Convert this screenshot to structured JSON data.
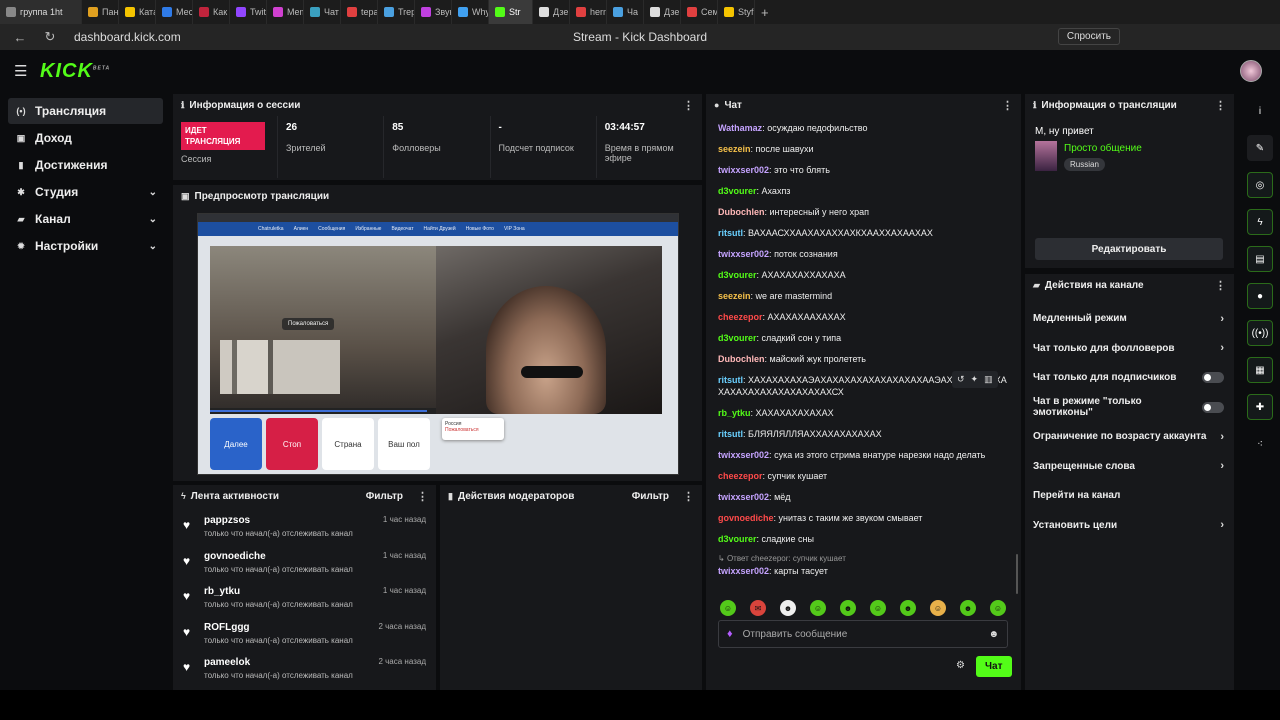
{
  "browser": {
    "tabs": [
      {
        "label": "группа 1ht",
        "icon": "speaker-icon",
        "color": "#888888"
      },
      {
        "label": "Пане",
        "icon": "tab-favicon",
        "color": "#e0a020"
      },
      {
        "label": "Катал",
        "icon": "tab-favicon",
        "color": "#f5c400"
      },
      {
        "label": "Месс",
        "icon": "tab-favicon",
        "color": "#2f7be8"
      },
      {
        "label": "Как о",
        "icon": "tab-favicon",
        "color": "#c0243c"
      },
      {
        "label": "Twitc",
        "icon": "tab-favicon",
        "color": "#9146ff"
      },
      {
        "label": "Memr",
        "icon": "tab-favicon",
        "color": "#d040d0"
      },
      {
        "label": "Чат р",
        "icon": "tab-favicon",
        "color": "#3aa0c0"
      },
      {
        "label": "tepa",
        "icon": "tab-favicon",
        "color": "#e04040"
      },
      {
        "label": "Trepa",
        "icon": "tab-favicon",
        "color": "#4aa0e0"
      },
      {
        "label": "Звук",
        "icon": "tab-favicon",
        "color": "#c040e0"
      },
      {
        "label": "Whyt",
        "icon": "tab-favicon",
        "color": "#40a0f0"
      },
      {
        "label": "Str",
        "icon": "kick-favicon",
        "color": "#53fc18"
      },
      {
        "label": "Дзен",
        "icon": "tab-favicon",
        "color": "#dddddd"
      },
      {
        "label": "herm",
        "icon": "tab-favicon",
        "color": "#e04040"
      },
      {
        "label": "Ча",
        "icon": "tab-favicon",
        "color": "#4aa0e0"
      },
      {
        "label": "Дзен",
        "icon": "tab-favicon",
        "color": "#dddddd"
      },
      {
        "label": "Семь",
        "icon": "tab-favicon",
        "color": "#e04040"
      },
      {
        "label": "Styfn",
        "icon": "tab-favicon",
        "color": "#f5c400"
      }
    ],
    "url": "dashboard.kick.com",
    "page_title": "Stream - Kick Dashboard",
    "ask_label": "Спросить"
  },
  "app": {
    "logo": "KICK",
    "logo_beta": "BETA"
  },
  "sidebar": {
    "items": [
      {
        "label": "Трансляция",
        "icon": "broadcast-icon",
        "glyph": "(•)",
        "active": true,
        "expandable": false
      },
      {
        "label": "Доход",
        "icon": "revenue-icon",
        "glyph": "▣",
        "active": false,
        "expandable": false
      },
      {
        "label": "Достижения",
        "icon": "achievements-icon",
        "glyph": "▮",
        "active": false,
        "expandable": false
      },
      {
        "label": "Студия",
        "icon": "studio-icon",
        "glyph": "✱",
        "active": false,
        "expandable": true
      },
      {
        "label": "Канал",
        "icon": "channel-icon",
        "glyph": "▰",
        "active": false,
        "expandable": true
      },
      {
        "label": "Настройки",
        "icon": "settings-icon",
        "glyph": "✹",
        "active": false,
        "expandable": true
      }
    ]
  },
  "session": {
    "title": "Информация о сессии",
    "live_badge": "ИДЕТ ТРАНСЛЯЦИЯ",
    "session_label": "Сессия",
    "stats": [
      {
        "value": "26",
        "label": "Зрителей"
      },
      {
        "value": "85",
        "label": "Фолловеры"
      },
      {
        "value": "-",
        "label": "Подсчет подписок"
      },
      {
        "value": "03:44:57",
        "label": "Время в прямом эфире"
      }
    ]
  },
  "preview": {
    "title": "Предпросмотр трансляции",
    "site_nav": [
      "Chatruletka",
      "Алиен",
      "Сообщения",
      "Избранные",
      "Видеочат",
      "Найти Друзей",
      "Новые Фото",
      "VIP Зона"
    ],
    "report_label": "Пожаловаться",
    "btn_next": "Далее",
    "btn_stop": "Стоп",
    "btn_country": "Страна",
    "btn_gender": "Ваш пол",
    "popup_country": "Россия",
    "popup_report": "Пожаловаться"
  },
  "activity": {
    "title": "Лента активности",
    "filter_label": "Фильтр",
    "items": [
      {
        "name": "pappzsos",
        "text": "только что начал(-а) отслеживать канал",
        "time": "1 час назад"
      },
      {
        "name": "govnoediche",
        "text": "только что начал(-а) отслеживать канал",
        "time": "1 час назад"
      },
      {
        "name": "rb_ytku",
        "text": "только что начал(-а) отслеживать канал",
        "time": "1 час назад"
      },
      {
        "name": "ROFLggg",
        "text": "только что начал(-а) отслеживать канал",
        "time": "2 часа назад"
      },
      {
        "name": "pameelok",
        "text": "только что начал(-а) отслеживать канал",
        "time": "2 часа назад"
      }
    ]
  },
  "moderator": {
    "title": "Действия модераторов",
    "filter_label": "Фильтр"
  },
  "chat": {
    "title": "Чат",
    "messages": [
      {
        "user": "Wathamaz",
        "color": "#c5a3ff",
        "text": "осуждаю педофильство"
      },
      {
        "user": "seezein",
        "color": "#f5c04a",
        "text": "после шавухи"
      },
      {
        "user": "twixxser002",
        "color": "#c5a3ff",
        "text": "это что блять"
      },
      {
        "user": "d3vourer",
        "color": "#53fc18",
        "text": "Ахахпз"
      },
      {
        "user": "Dubochlen",
        "color": "#ffb8b8",
        "text": "интересный у него храп"
      },
      {
        "user": "ritsutl",
        "color": "#6ad0ff",
        "text": "ВАХААСХХААХАХАХХАХКХААХХАХААХАХ"
      },
      {
        "user": "twixxser002",
        "color": "#c5a3ff",
        "text": "поток сознания"
      },
      {
        "user": "d3vourer",
        "color": "#53fc18",
        "text": "АХАХАХАХХАХАХА"
      },
      {
        "user": "seezein",
        "color": "#f5c04a",
        "text": "we are mastermind"
      },
      {
        "user": "cheezepor",
        "color": "#ff4a4a",
        "text": "АХАХАХААХАХАХ"
      },
      {
        "user": "d3vourer",
        "color": "#53fc18",
        "text": "сладкий сон у типа"
      },
      {
        "user": "Dubochlen",
        "color": "#ffb8b8",
        "text": "майский жук пролететь"
      },
      {
        "user": "ritsutl",
        "color": "#6ad0ff",
        "text": "ХАХАХАХАХАЭАХАХАХАХАХАХАХАХАХААЭАХАХАХАХАХАХАХАХАХАХАХАХАХАХАХСХ"
      },
      {
        "user": "rb_ytku",
        "color": "#53fc18",
        "text": "ХАХАХАХАХАХАХ"
      },
      {
        "user": "ritsutl",
        "color": "#6ad0ff",
        "text": "БЛЯЯЛЯЛЛЯАХХАХАХАХАХАХ"
      },
      {
        "user": "twixxser002",
        "color": "#c5a3ff",
        "text": "сука из этого стрима внатуре нарезки надо делать"
      },
      {
        "user": "cheezepor",
        "color": "#ff4a4a",
        "text": "супчик кушает"
      },
      {
        "user": "twixxser002",
        "color": "#c5a3ff",
        "text": "мёд"
      },
      {
        "user": "govnoediche",
        "color": "#ff4a4a",
        "text": "унитаз с таким же звуком смывает"
      },
      {
        "user": "d3vourer",
        "color": "#53fc18",
        "text": "сладкие сны"
      }
    ],
    "reply_label": "Ответ cheezepor: супчик кушает",
    "last_message": {
      "user": "twixxser002",
      "color": "#c5a3ff",
      "text": "карты тасует"
    },
    "input_placeholder": "Отправить сообщение",
    "send_label": "Чат"
  },
  "stream_info": {
    "title": "Информация о трансляции",
    "stream_title": "М, ну привет",
    "category": "Просто общение",
    "tag": "Russian",
    "edit_label": "Редактировать"
  },
  "channel_actions": {
    "title": "Действия на канале",
    "items": [
      {
        "label": "Медленный режим",
        "control": "chevron"
      },
      {
        "label": "Чат только для фолловеров",
        "control": "chevron"
      },
      {
        "label": "Чат только для подписчиков",
        "control": "toggle"
      },
      {
        "label": "Чат в режиме \"только эмотиконы\"",
        "control": "toggle"
      },
      {
        "label": "Ограничение по возрасту аккаунта",
        "control": "chevron"
      },
      {
        "label": "Запрещенные слова",
        "control": "chevron"
      },
      {
        "label": "Перейти на канал",
        "control": "none"
      },
      {
        "label": "Установить цели",
        "control": "chevron"
      }
    ]
  },
  "rail": {
    "buttons": [
      {
        "icon": "info-icon",
        "glyph": "i"
      },
      {
        "icon": "pencil-icon",
        "glyph": "✎"
      },
      {
        "icon": "screenshot-icon",
        "glyph": "◎"
      },
      {
        "icon": "lightning-icon",
        "glyph": "ϟ"
      },
      {
        "icon": "document-icon",
        "glyph": "▤"
      },
      {
        "icon": "chat-bubble-icon",
        "glyph": "●"
      },
      {
        "icon": "broadcast-signal-icon",
        "glyph": "((•))"
      },
      {
        "icon": "storage-icon",
        "glyph": "▦"
      },
      {
        "icon": "wrench-icon",
        "glyph": "✚"
      },
      {
        "icon": "share-icon",
        "glyph": "⁖"
      }
    ]
  },
  "colors": {
    "brand": "#53fc18",
    "live": "#e31b4e",
    "panel": "#17181b",
    "background": "#0b0c0e"
  }
}
